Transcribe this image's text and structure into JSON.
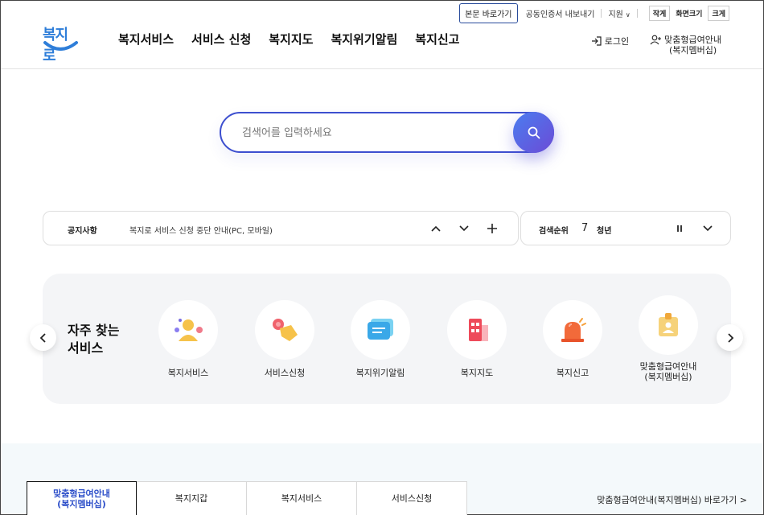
{
  "utility": {
    "skip": "본문 바로가기",
    "cert": "공동인증서 내보내기",
    "support": "지원",
    "size_small": "작게",
    "size_label": "화면크기",
    "size_large": "크게"
  },
  "logo": {
    "text": "복지로"
  },
  "gnb": [
    "복지서비스",
    "서비스 신청",
    "복지지도",
    "복지위기알림",
    "복지신고"
  ],
  "header": {
    "login": "로그인",
    "member_line1": "맞춤형급여안내",
    "member_line2": "(복지멤버십)"
  },
  "search": {
    "placeholder": "검색어를 입력하세요"
  },
  "notice": {
    "label": "공지사항",
    "text": "복지로 서비스 신청 중단 안내(PC, 모바일)"
  },
  "rank": {
    "label": "검색순위",
    "number": "7",
    "word": "청년"
  },
  "frequent": {
    "title_line1": "자주 찾는",
    "title_line2": "서비스",
    "items": [
      {
        "label": "복지서비스",
        "icon": "people-icon"
      },
      {
        "label": "서비스신청",
        "icon": "hand-click-icon"
      },
      {
        "label": "복지위기알림",
        "icon": "message-icon"
      },
      {
        "label": "복지지도",
        "icon": "building-icon"
      },
      {
        "label": "복지신고",
        "icon": "siren-icon"
      },
      {
        "label": "맞춤형급여안내",
        "label2": "(복지멤버십)",
        "icon": "id-card-icon"
      }
    ]
  },
  "tabs": [
    {
      "line1": "맞춤형급여안내",
      "line2": "(복지멤버십)"
    },
    {
      "line1": "복지지갑"
    },
    {
      "line1": "복지서비스"
    },
    {
      "line1": "서비스신청"
    }
  ],
  "goto": "맞춤형급여안내(복지멤버십) 바로가기 >",
  "colors": {
    "accent": "#3d4fcf",
    "logo": "#2e7ed9",
    "active_tab": "#2c4ec9",
    "panel_bg": "#f4f5f7"
  }
}
